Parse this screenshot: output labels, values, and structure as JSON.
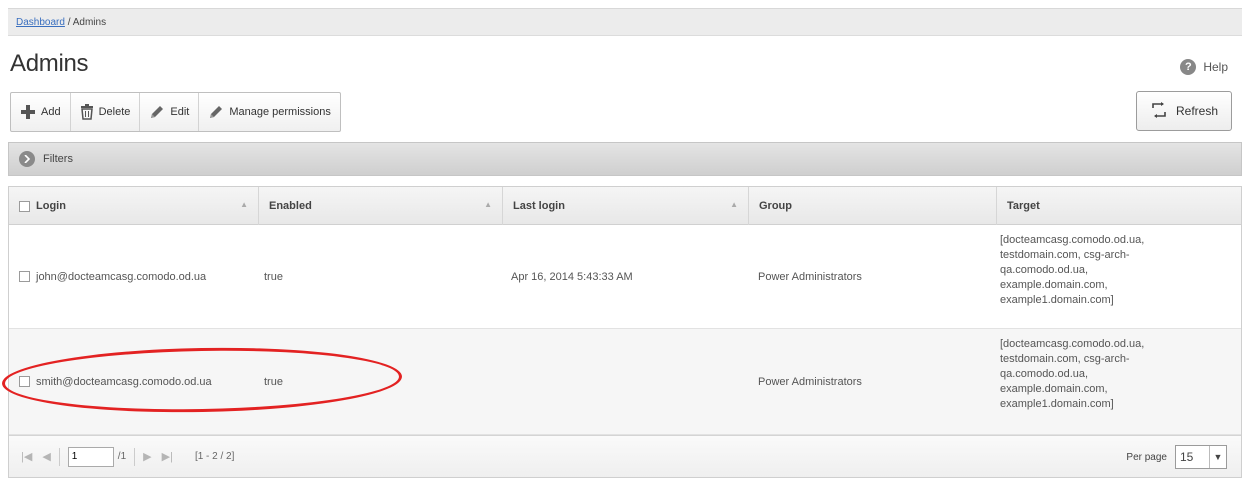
{
  "breadcrumb": {
    "dashboard_link": "Dashboard",
    "separator": " / ",
    "current": "Admins"
  },
  "page": {
    "title": "Admins",
    "help_label": "Help",
    "help_icon": "?"
  },
  "toolbar": {
    "add_label": "Add",
    "delete_label": "Delete",
    "edit_label": "Edit",
    "manage_permissions_label": "Manage permissions",
    "refresh_label": "Refresh"
  },
  "filters": {
    "label": "Filters"
  },
  "grid": {
    "columns": [
      "Login",
      "Enabled",
      "Last login",
      "Group",
      "Target"
    ],
    "rows": [
      {
        "login": "john@docteamcasg.comodo.od.ua",
        "enabled": "true",
        "last_login": "Apr 16, 2014 5:43:33 AM",
        "group": "Power Administrators",
        "target": "[docteamcasg.comodo.od.ua,\ntestdomain.com, csg-arch-\nqa.comodo.od.ua,\nexample.domain.com,\nexample1.domain.com]"
      },
      {
        "login": "smith@docteamcasg.comodo.od.ua",
        "enabled": "true",
        "last_login": "",
        "group": "Power Administrators",
        "target": "[docteamcasg.comodo.od.ua,\ntestdomain.com, csg-arch-\nqa.comodo.od.ua,\nexample.domain.com,\nexample1.domain.com]"
      }
    ]
  },
  "pager": {
    "current_page": "1",
    "total_pages": "/1",
    "range": "[1 - 2 / 2]",
    "per_page_label": "Per page",
    "per_page_value": "15"
  },
  "colors": {
    "link": "#3a6fbf",
    "highlight": "#e32222",
    "filter_bar": "#d8d8d8"
  }
}
